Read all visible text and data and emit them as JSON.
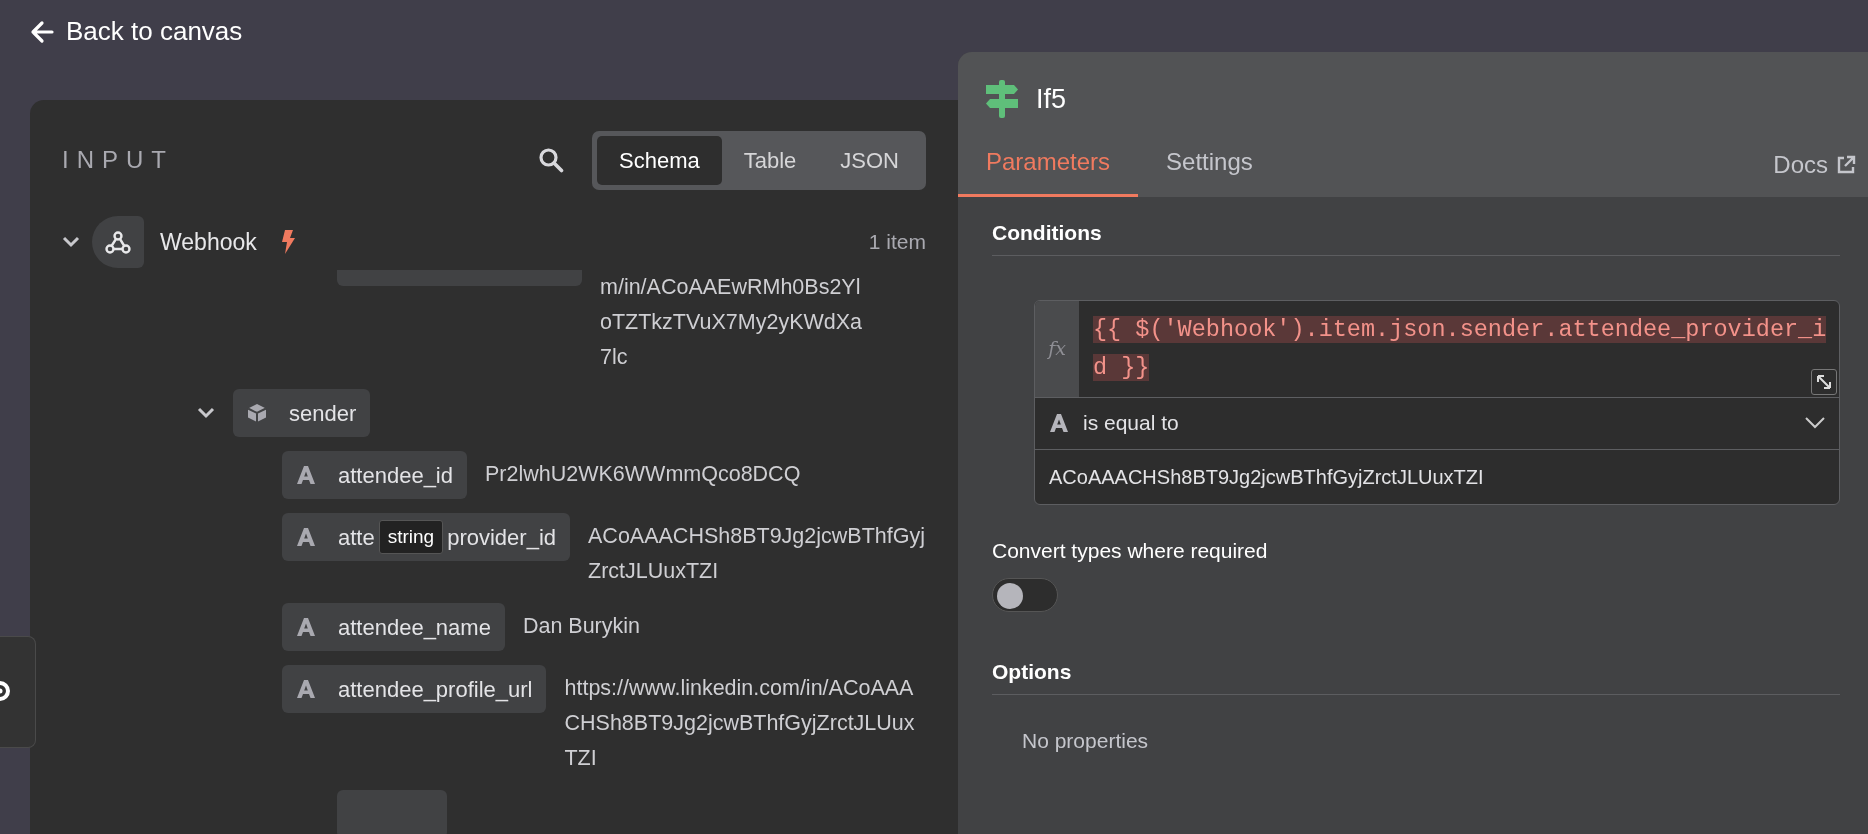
{
  "header": {
    "back_label": "Back to canvas"
  },
  "input_panel": {
    "title": "INPUT",
    "views": [
      {
        "label": "Schema",
        "selected": true
      },
      {
        "label": "Table",
        "selected": false
      },
      {
        "label": "JSON",
        "selected": false
      }
    ],
    "node": {
      "name": "Webhook",
      "expanded": true,
      "count": "1 item"
    },
    "fields": [
      {
        "kind": "clipped",
        "value": "m/in/ACoAAEwRMh0Bs2YloTZTkzTVuX7My2yKWdXa7lc"
      },
      {
        "kind": "object",
        "key": "sender",
        "expanded": true,
        "children": [
          {
            "kind": "string",
            "key": "attendee_id",
            "value": "Pr2lwhU2WK6WWmmQco8DCQ"
          },
          {
            "kind": "string",
            "key_start": "atte",
            "key_end": "provider_id",
            "value": "ACoAAACHSh8BT9Jg2jcwBThfGyjZrctJLUuxTZI",
            "tooltip": "string"
          },
          {
            "kind": "string",
            "key": "attendee_name",
            "value": "Dan Burykin"
          },
          {
            "kind": "string",
            "key": "attendee_profile_url",
            "value": "https://www.linkedin.com/in/ACoAAACHSh8BT9Jg2jcwBThfGyjZrctJLUuxTZI"
          }
        ]
      },
      {
        "kind": "cutoff"
      }
    ]
  },
  "node_panel": {
    "title": "If5",
    "tabs": [
      {
        "label": "Parameters",
        "selected": true
      },
      {
        "label": "Settings",
        "selected": false
      }
    ],
    "docs_label": "Docs",
    "conditions": {
      "title": "Conditions",
      "fx_label": "fx",
      "expression": "{{ $('Webhook').item.json.sender.attendee_provider_id }}",
      "operator": "is equal to",
      "value": "ACoAAACHSh8BT9Jg2jcwBThfGyjZrctJLUuxTZI"
    },
    "convert_types": {
      "label": "Convert types where required",
      "on": false
    },
    "options": {
      "title": "Options",
      "empty_text": "No properties"
    }
  }
}
